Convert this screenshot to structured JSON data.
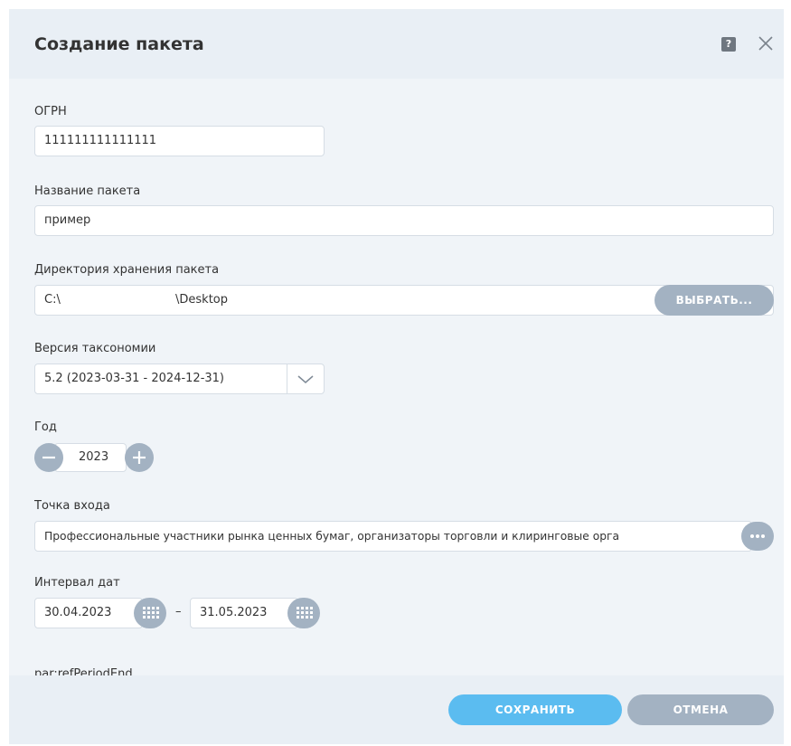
{
  "dialog": {
    "title": "Создание пакета",
    "help_glyph": "?",
    "close_glyph": "✕"
  },
  "fields": {
    "ogrn": {
      "label": "ОГРН",
      "value": "111111111111111"
    },
    "package_name": {
      "label": "Название пакета",
      "value": "пример"
    },
    "directory": {
      "label": "Директория хранения пакета",
      "value_prefix": "C:\\",
      "value_suffix": "\\Desktop",
      "button_label": "ВЫБРАТЬ..."
    },
    "taxonomy": {
      "label": "Версия таксономии",
      "selected": "5.2 (2023-03-31 - 2024-12-31)"
    },
    "year": {
      "label": "Год",
      "value": "2023"
    },
    "entry_point": {
      "label": "Точка входа",
      "value": "Профессиональные участники рынка ценных бумаг, организаторы торговли и клиринговые орга"
    },
    "date_range": {
      "label": "Интервал дат",
      "from": "30.04.2023",
      "separator": "–",
      "to": "31.05.2023"
    },
    "period_end": {
      "label": "par:refPeriodEnd"
    }
  },
  "footer": {
    "save_label": "СОХРАНИТЬ",
    "cancel_label": "ОТМЕНА"
  },
  "colors": {
    "save_button": "#5bbcf0",
    "cancel_button": "#a3b2c2",
    "select_button": "#a3b2c2"
  }
}
